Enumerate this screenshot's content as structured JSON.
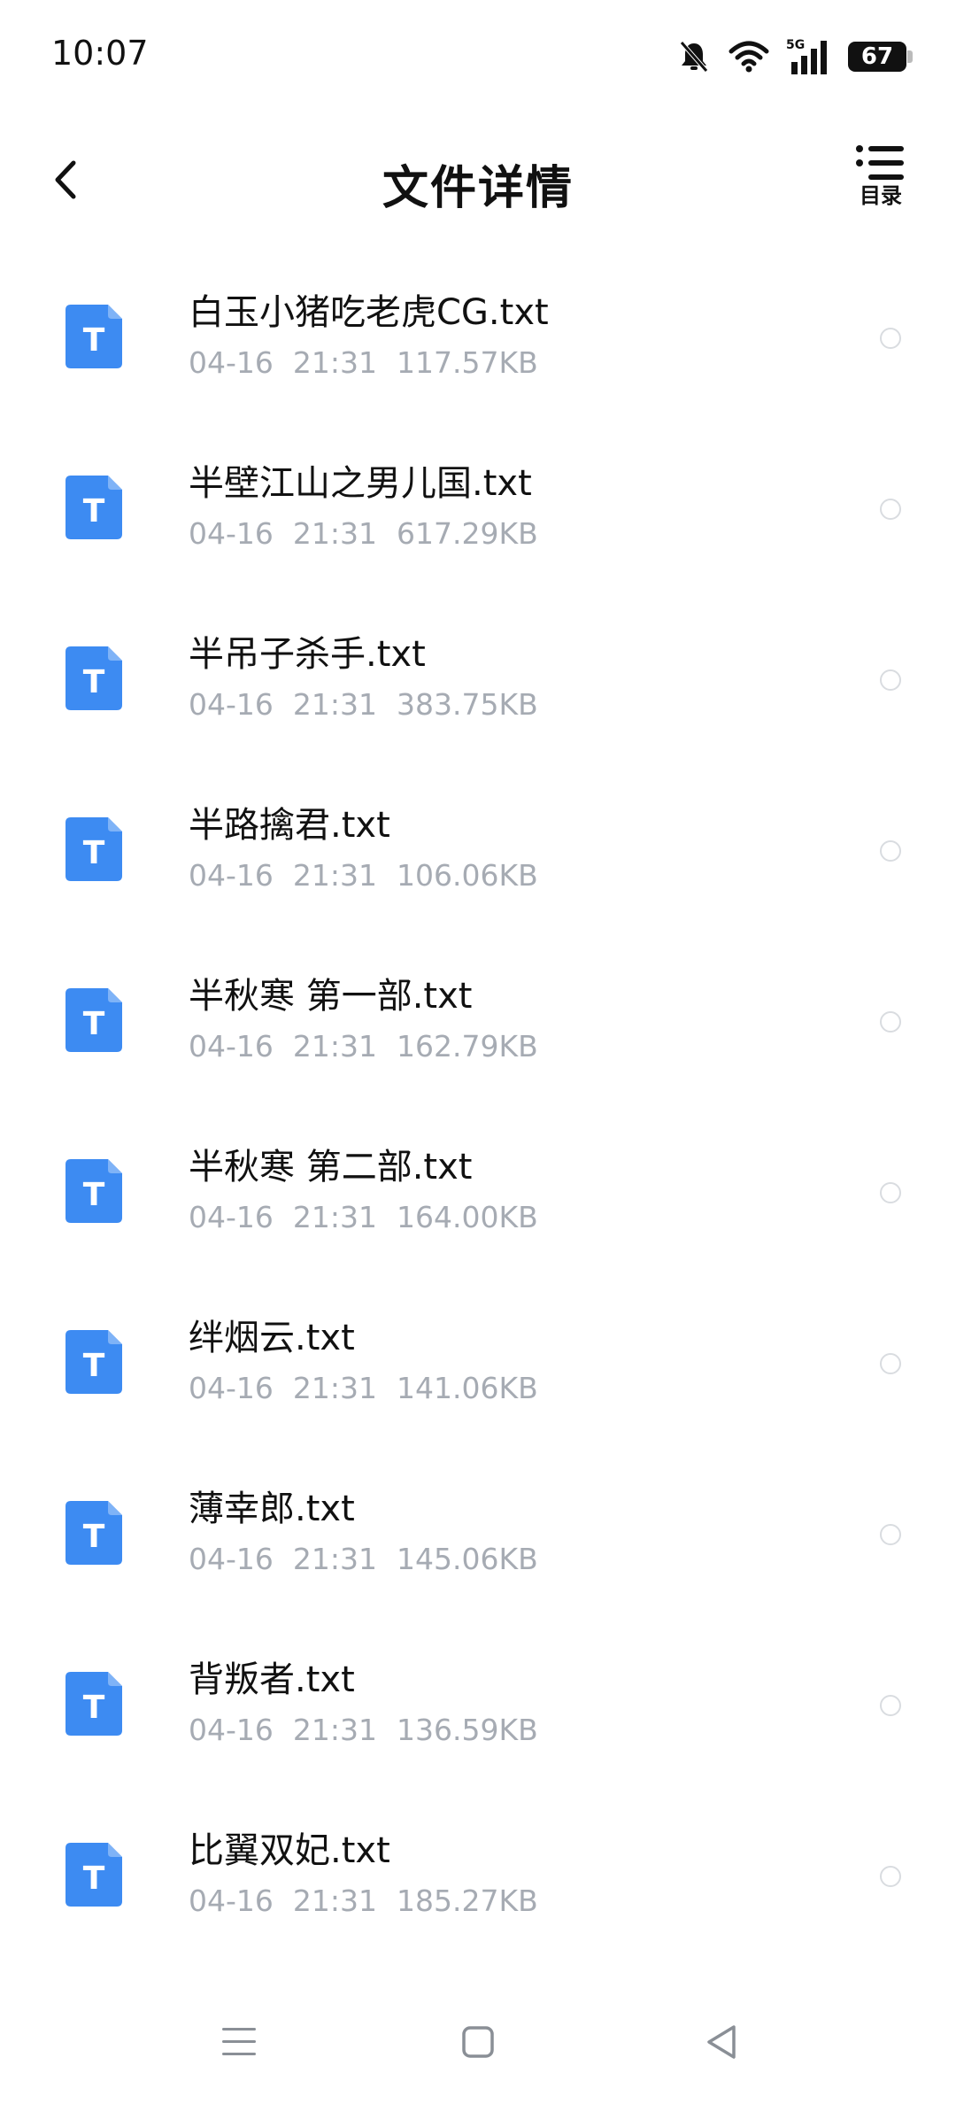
{
  "status_bar": {
    "time": "10:07",
    "network": "5G",
    "battery": "67",
    "icons": [
      "mute-bell-icon",
      "wifi-icon",
      "signal-5g-icon",
      "battery-icon"
    ]
  },
  "header": {
    "title": "文件详情",
    "catalog_label": "目录",
    "back_icon": "chevron-left-icon",
    "catalog_icon": "list-icon"
  },
  "files": [
    {
      "name": "白玉小猪吃老虎CG.txt",
      "date": "04-16",
      "time": "21:31",
      "size": "117.57KB",
      "icon_letter": "T"
    },
    {
      "name": "半壁江山之男儿国.txt",
      "date": "04-16",
      "time": "21:31",
      "size": "617.29KB",
      "icon_letter": "T"
    },
    {
      "name": "半吊子杀手.txt",
      "date": "04-16",
      "time": "21:31",
      "size": "383.75KB",
      "icon_letter": "T"
    },
    {
      "name": "半路擒君.txt",
      "date": "04-16",
      "time": "21:31",
      "size": "106.06KB",
      "icon_letter": "T"
    },
    {
      "name": "半秋寒 第一部.txt",
      "date": "04-16",
      "time": "21:31",
      "size": "162.79KB",
      "icon_letter": "T"
    },
    {
      "name": "半秋寒 第二部.txt",
      "date": "04-16",
      "time": "21:31",
      "size": "164.00KB",
      "icon_letter": "T"
    },
    {
      "name": "绊烟云.txt",
      "date": "04-16",
      "time": "21:31",
      "size": "141.06KB",
      "icon_letter": "T"
    },
    {
      "name": "薄幸郎.txt",
      "date": "04-16",
      "time": "21:31",
      "size": "145.06KB",
      "icon_letter": "T"
    },
    {
      "name": "背叛者.txt",
      "date": "04-16",
      "time": "21:31",
      "size": "136.59KB",
      "icon_letter": "T"
    },
    {
      "name": "比翼双妃.txt",
      "date": "04-16",
      "time": "21:31",
      "size": "185.27KB",
      "icon_letter": "T"
    }
  ],
  "colors": {
    "accent": "#3d8bf2",
    "meta_text": "#a6abb3",
    "radio_border": "#d9dce0"
  },
  "nav_bar": {
    "icons": [
      "menu-icon",
      "home-square-icon",
      "back-triangle-icon"
    ]
  }
}
